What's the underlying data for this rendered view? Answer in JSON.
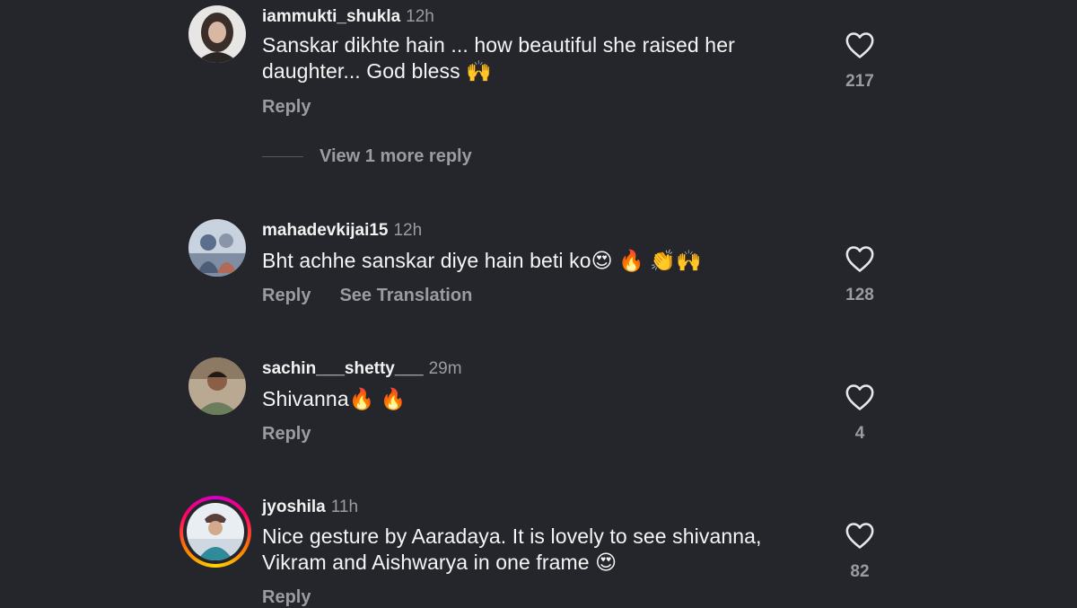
{
  "comments": [
    {
      "username": "iammukti_shukla",
      "time": "12h",
      "text": "Sanskar dikhte hain ... how beautiful she raised her daughter... God bless 🙌",
      "actions": [
        "Reply"
      ],
      "likes": "217",
      "view_more": "View 1 more reply"
    },
    {
      "username": "mahadevkijai15",
      "time": "12h",
      "text": "Bht achhe sanskar diye hain beti ko😍 🔥 👏🙌",
      "actions": [
        "Reply",
        "See Translation"
      ],
      "likes": "128"
    },
    {
      "username": "sachin___shetty___",
      "time": "29m",
      "text": "Shivanna🔥 🔥",
      "actions": [
        "Reply"
      ],
      "likes": "4"
    },
    {
      "username": "jyoshila",
      "time": "11h",
      "text": "Nice gesture by Aaradaya. It is lovely to see shivanna, Vikram and Aishwarya in one frame 😍",
      "actions": [
        "Reply"
      ],
      "likes": "82"
    }
  ],
  "colors": {
    "background": "#24262c",
    "secondary_text": "#9a9ca2",
    "story_ring": "#ff0069"
  },
  "icons": {
    "like": "heart-outline-icon"
  }
}
